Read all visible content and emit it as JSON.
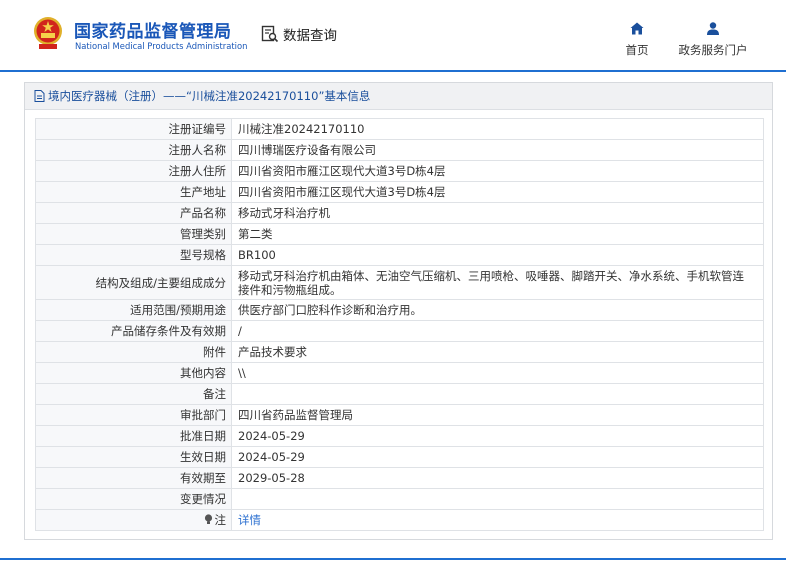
{
  "header": {
    "logo_cn": "国家药品监督管理局",
    "logo_en": "National Medical Products Administration",
    "query_label": "数据查询",
    "nav": [
      {
        "label": "首页",
        "icon": "home-icon"
      },
      {
        "label": "政务服务门户",
        "icon": "user-icon"
      }
    ]
  },
  "panel": {
    "title": "境内医疗器械（注册）——“川械注准20242170110”基本信息"
  },
  "details": {
    "rows": [
      {
        "key": "注册证编号",
        "value": "川械注准20242170110"
      },
      {
        "key": "注册人名称",
        "value": "四川博瑞医疗设备有限公司"
      },
      {
        "key": "注册人住所",
        "value": "四川省资阳市雁江区现代大道3号D栋4层"
      },
      {
        "key": "生产地址",
        "value": "四川省资阳市雁江区现代大道3号D栋4层"
      },
      {
        "key": "产品名称",
        "value": "移动式牙科治疗机"
      },
      {
        "key": "管理类别",
        "value": "第二类"
      },
      {
        "key": "型号规格",
        "value": "BR100"
      },
      {
        "key": "结构及组成/主要组成成分",
        "value": "移动式牙科治疗机由箱体、无油空气压缩机、三用喷枪、吸唾器、脚踏开关、净水系统、手机软管连接件和污物瓶组成。"
      },
      {
        "key": "适用范围/预期用途",
        "value": "供医疗部门口腔科作诊断和治疗用。"
      },
      {
        "key": "产品储存条件及有效期",
        "value": "/"
      },
      {
        "key": "附件",
        "value": "产品技术要求"
      },
      {
        "key": "其他内容",
        "value": "\\\\"
      },
      {
        "key": "备注",
        "value": ""
      },
      {
        "key": "审批部门",
        "value": "四川省药品监督管理局"
      },
      {
        "key": "批准日期",
        "value": "2024-05-29"
      },
      {
        "key": "生效日期",
        "value": "2024-05-29"
      },
      {
        "key": "有效期至",
        "value": "2029-05-28"
      },
      {
        "key": "变更情况",
        "value": ""
      }
    ],
    "note_key": "注",
    "note_value": "详情"
  },
  "colors": {
    "brand_blue": "#1a57b8",
    "accent_line": "#1f6fd1",
    "link": "#2b6fd0"
  }
}
